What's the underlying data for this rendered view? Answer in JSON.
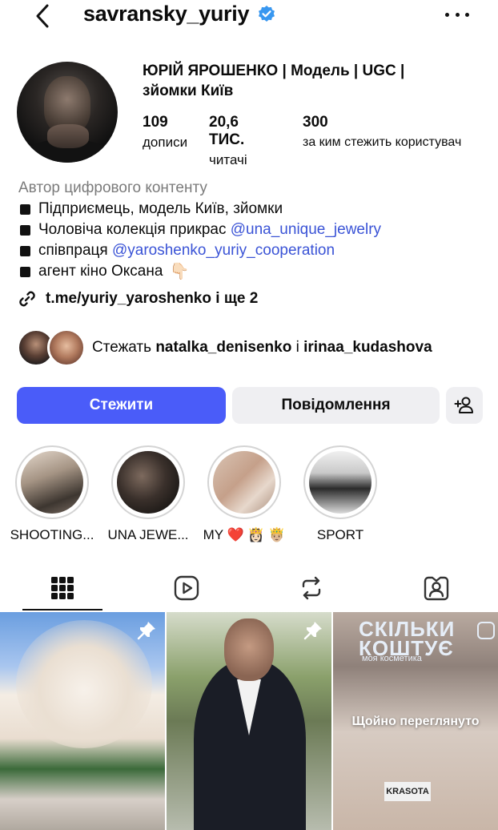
{
  "header": {
    "username": "savransky_yuriy"
  },
  "profile": {
    "display_name": "ЮРІЙ ЯРОШЕНКО | Модель | UGC | зйомки Київ",
    "stats": [
      {
        "value": "109",
        "label": "дописи"
      },
      {
        "value": "20,6 ТИС.",
        "label": "читачі"
      },
      {
        "value": "300",
        "label": "за ким стежить користувач"
      }
    ],
    "category": "Автор цифрового контенту",
    "bio": {
      "line1": "Підприємець, модель Київ, зйомки",
      "line2_text": "Чоловіча колекція прикрас ",
      "line2_mention": "@una_unique_jewelry",
      "line3_text": "співпраця ",
      "line3_mention": "@yaroshenko_yuriy_cooperation",
      "line4": "агент кіно Оксана",
      "line4_emoji": "👇🏻"
    },
    "link": "t.me/yuriy_yaroshenko і ще 2",
    "followed_by": {
      "prefix": "Стежать ",
      "user1": "natalka_denisenko",
      "joiner": " і ",
      "user2": "irinaa_kudashova"
    }
  },
  "actions": {
    "follow": "Стежити",
    "message": "Повідомлення"
  },
  "highlights": [
    {
      "label": "SHOOTING..."
    },
    {
      "label": "UNA JEWE..."
    },
    {
      "label": "MY ❤️ 👸🏻 🤴🏼"
    },
    {
      "label": "SPORT"
    }
  ],
  "grid": {
    "post3_brand_line1": "СКІЛЬКИ",
    "post3_brand_line2": "КОШТУЄ",
    "post3_brand_line3": "моя косметика",
    "post3_overlay": "Щойно переглянуто",
    "post3_sign": "KRASOTA"
  },
  "colors": {
    "accent": "#4a5cf9",
    "mention": "#3a53d6",
    "verified": "#3897f0",
    "secondary_button": "#efeff2"
  }
}
